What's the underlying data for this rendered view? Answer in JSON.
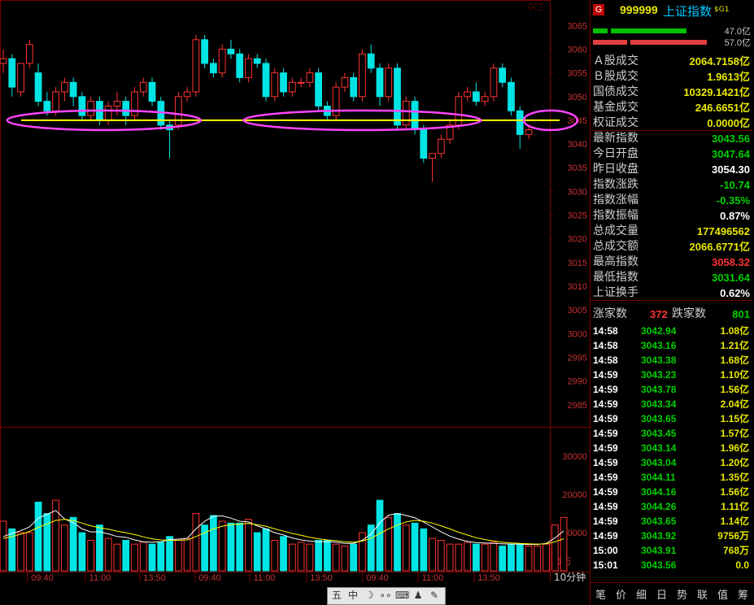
{
  "chart_data": {
    "type": "candlestick",
    "price_axis": {
      "ticks": [
        3065,
        3060,
        3055,
        3050,
        3045,
        3040,
        3035,
        3030,
        3025,
        3020,
        3015,
        3010,
        3005,
        3000,
        2995,
        2990,
        2985
      ],
      "min": 2980.5,
      "max": 3069.0
    },
    "volume_axis": {
      "ticks": [
        30000,
        20000,
        10000
      ],
      "unit_label": "X1万",
      "max": 36000
    },
    "x_tick_labels": [
      "09:40",
      "11:00",
      "13:50",
      "09:40",
      "11:00",
      "13:50",
      "09:40",
      "11:00",
      "13:50"
    ],
    "period_label": "10分钟",
    "candles": [
      {
        "o": 3057,
        "h": 3060,
        "l": 3055,
        "c": 3058
      },
      {
        "o": 3058,
        "h": 3059,
        "l": 3050,
        "c": 3052
      },
      {
        "o": 3051,
        "h": 3057,
        "l": 3050,
        "c": 3057
      },
      {
        "o": 3057,
        "h": 3062,
        "l": 3056,
        "c": 3061
      },
      {
        "o": 3055,
        "h": 3057,
        "l": 3048,
        "c": 3049
      },
      {
        "o": 3049,
        "h": 3051,
        "l": 3046,
        "c": 3047
      },
      {
        "o": 3047,
        "h": 3052,
        "l": 3046,
        "c": 3051
      },
      {
        "o": 3051,
        "h": 3054,
        "l": 3049,
        "c": 3053
      },
      {
        "o": 3053,
        "h": 3054,
        "l": 3048,
        "c": 3050
      },
      {
        "o": 3050,
        "h": 3051,
        "l": 3045,
        "c": 3046
      },
      {
        "o": 3046,
        "h": 3050,
        "l": 3045,
        "c": 3049
      },
      {
        "o": 3049,
        "h": 3050,
        "l": 3044,
        "c": 3045
      },
      {
        "o": 3045,
        "h": 3049,
        "l": 3044,
        "c": 3048
      },
      {
        "o": 3048,
        "h": 3051,
        "l": 3046,
        "c": 3049
      },
      {
        "o": 3049,
        "h": 3050,
        "l": 3044,
        "c": 3046
      },
      {
        "o": 3046,
        "h": 3052,
        "l": 3045,
        "c": 3051
      },
      {
        "o": 3051,
        "h": 3054,
        "l": 3050,
        "c": 3053
      },
      {
        "o": 3053,
        "h": 3054,
        "l": 3048,
        "c": 3049
      },
      {
        "o": 3049,
        "h": 3050,
        "l": 3043,
        "c": 3044
      },
      {
        "o": 3044,
        "h": 3045,
        "l": 3037,
        "c": 3043
      },
      {
        "o": 3044,
        "h": 3051,
        "l": 3043,
        "c": 3050
      },
      {
        "o": 3050,
        "h": 3052,
        "l": 3049,
        "c": 3051
      },
      {
        "o": 3051,
        "h": 3063,
        "l": 3050,
        "c": 3062
      },
      {
        "o": 3062,
        "h": 3063,
        "l": 3056,
        "c": 3057
      },
      {
        "o": 3057,
        "h": 3058,
        "l": 3054,
        "c": 3055
      },
      {
        "o": 3055,
        "h": 3061,
        "l": 3054,
        "c": 3060
      },
      {
        "o": 3060,
        "h": 3062,
        "l": 3058,
        "c": 3059
      },
      {
        "o": 3059,
        "h": 3060,
        "l": 3053,
        "c": 3054
      },
      {
        "o": 3054,
        "h": 3059,
        "l": 3053,
        "c": 3058
      },
      {
        "o": 3058,
        "h": 3059,
        "l": 3056,
        "c": 3057
      },
      {
        "o": 3057,
        "h": 3058,
        "l": 3049,
        "c": 3050
      },
      {
        "o": 3050,
        "h": 3056,
        "l": 3049,
        "c": 3055
      },
      {
        "o": 3055,
        "h": 3056,
        "l": 3050,
        "c": 3051
      },
      {
        "o": 3051,
        "h": 3054,
        "l": 3050,
        "c": 3053
      },
      {
        "o": 3053,
        "h": 3054,
        "l": 3052,
        "c": 3053
      },
      {
        "o": 3053,
        "h": 3056,
        "l": 3052,
        "c": 3055
      },
      {
        "o": 3055,
        "h": 3056,
        "l": 3047,
        "c": 3048
      },
      {
        "o": 3048,
        "h": 3049,
        "l": 3045,
        "c": 3046
      },
      {
        "o": 3046,
        "h": 3053,
        "l": 3045,
        "c": 3052
      },
      {
        "o": 3052,
        "h": 3055,
        "l": 3051,
        "c": 3054
      },
      {
        "o": 3054,
        "h": 3055,
        "l": 3049,
        "c": 3050
      },
      {
        "o": 3050,
        "h": 3060,
        "l": 3049,
        "c": 3059
      },
      {
        "o": 3059,
        "h": 3061,
        "l": 3055,
        "c": 3056
      },
      {
        "o": 3056,
        "h": 3057,
        "l": 3048,
        "c": 3050
      },
      {
        "o": 3050,
        "h": 3057,
        "l": 3049,
        "c": 3056
      },
      {
        "o": 3056,
        "h": 3057,
        "l": 3043,
        "c": 3044
      },
      {
        "o": 3044,
        "h": 3050,
        "l": 3043,
        "c": 3049
      },
      {
        "o": 3049,
        "h": 3050,
        "l": 3042,
        "c": 3043
      },
      {
        "o": 3043,
        "h": 3044,
        "l": 3036,
        "c": 3037
      },
      {
        "o": 3037,
        "h": 3038,
        "l": 3032,
        "c": 3038
      },
      {
        "o": 3038,
        "h": 3042,
        "l": 3037,
        "c": 3041
      },
      {
        "o": 3041,
        "h": 3045,
        "l": 3040,
        "c": 3044
      },
      {
        "o": 3044,
        "h": 3051,
        "l": 3043,
        "c": 3050
      },
      {
        "o": 3050,
        "h": 3052,
        "l": 3049,
        "c": 3051
      },
      {
        "o": 3051,
        "h": 3053,
        "l": 3048,
        "c": 3049
      },
      {
        "o": 3049,
        "h": 3051,
        "l": 3048,
        "c": 3050
      },
      {
        "o": 3050,
        "h": 3057,
        "l": 3049,
        "c": 3056
      },
      {
        "o": 3056,
        "h": 3057,
        "l": 3052,
        "c": 3053
      },
      {
        "o": 3053,
        "h": 3054,
        "l": 3046,
        "c": 3047
      },
      {
        "o": 3047,
        "h": 3048,
        "l": 3039,
        "c": 3042
      },
      {
        "o": 3042,
        "h": 3044,
        "l": 3041,
        "c": 3043
      }
    ],
    "volumes": [
      13000,
      11000,
      10000,
      10000,
      18000,
      15000,
      18500,
      12000,
      14000,
      10000,
      8000,
      12000,
      8500,
      7000,
      8000,
      7000,
      7500,
      7000,
      7500,
      9000,
      8000,
      8500,
      15000,
      12000,
      14500,
      13000,
      12500,
      12500,
      13500,
      10000,
      11000,
      8000,
      9000,
      7000,
      7500,
      7000,
      8000,
      8000,
      7000,
      6500,
      7000,
      10000,
      12000,
      18500,
      14000,
      15000,
      12000,
      12500,
      11000,
      8500,
      8000,
      7000,
      7000,
      7500,
      7000,
      7000,
      7500,
      6500,
      7000,
      7000,
      6500,
      6500,
      7000,
      12000,
      14000
    ],
    "ma_lines": [
      {
        "color": "#ffffff",
        "values": [
          9000,
          9800,
          10500,
          11500,
          13800,
          14800,
          15800,
          13600,
          12600,
          11000,
          10200,
          10200,
          9700,
          9000,
          8800,
          8100,
          7600,
          7500,
          7600,
          8200,
          8300,
          8500,
          11000,
          13000,
          14300,
          14400,
          13800,
          13000,
          12800,
          11800,
          11000,
          10000,
          9400,
          8600,
          8100,
          7800,
          7600,
          7700,
          7500,
          7200,
          7200,
          8000,
          9600,
          12600,
          14600,
          15000,
          14500,
          13900,
          12800,
          11500,
          10200,
          9100,
          8300,
          7700,
          7400,
          7300,
          7200,
          7100,
          7000,
          7000,
          6900,
          6900,
          7200,
          8600,
          10500
        ]
      },
      {
        "color": "#ffff00",
        "values": [
          8500,
          9000,
          9600,
          10300,
          11400,
          12300,
          13200,
          13500,
          13200,
          12500,
          11800,
          11300,
          10900,
          10400,
          10000,
          9500,
          8900,
          8400,
          8100,
          8000,
          8000,
          8100,
          9000,
          10000,
          11000,
          11700,
          12100,
          12300,
          12400,
          12100,
          11700,
          11000,
          10400,
          9800,
          9300,
          8800,
          8400,
          8100,
          7900,
          7600,
          7500,
          7800,
          8500,
          9800,
          11000,
          12000,
          12800,
          13200,
          13000,
          12500,
          11800,
          11000,
          10100,
          9400,
          8700,
          8200,
          7800,
          7500,
          7300,
          7200,
          7100,
          7000,
          7100,
          7600,
          8400
        ]
      }
    ],
    "support_line": 3045,
    "annotations": [
      {
        "shape": "ellipse",
        "from_candle": 1,
        "to_candle": 22,
        "level": 3045
      },
      {
        "shape": "ellipse",
        "from_candle": 28,
        "to_candle": 54,
        "level": 3045
      },
      {
        "shape": "ellipse",
        "from_candle": 60,
        "to_candle": 65,
        "level": 3045
      }
    ]
  },
  "colors": {
    "up": "#ff3232",
    "down": "#00e4e4",
    "grid": "#7a0000",
    "support": "#ffff00",
    "annotation": "#ff44ff",
    "green": "#00d000",
    "red": "#ff3232",
    "yellow": "#e8e800"
  },
  "panel": {
    "badge": "G",
    "code": "999999",
    "name": "上证指数",
    "tag": "$G1",
    "bar1_value": "47.0亿",
    "bar1_fraction": 0.45,
    "bar2_value": "57.0亿",
    "bar2_fraction": 0.55,
    "stats": [
      {
        "label": "Ａ股成交",
        "value": "2064.7158亿",
        "color": "#e8e800"
      },
      {
        "label": "Ｂ股成交",
        "value": "1.9613亿",
        "color": "#e8e800"
      },
      {
        "label": "国债成交",
        "value": "10329.1421亿",
        "color": "#e8e800"
      },
      {
        "label": "基金成交",
        "value": "246.6651亿",
        "color": "#e8e800"
      },
      {
        "label": "权证成交",
        "value": "0.0000亿",
        "color": "#e8e800"
      },
      {
        "label": "最新指数",
        "value": "3043.56",
        "color": "#00d000"
      },
      {
        "label": "今日开盘",
        "value": "3047.64",
        "color": "#00d000"
      },
      {
        "label": "昨日收盘",
        "value": "3054.30",
        "color": "#ffffff"
      },
      {
        "label": "指数涨跌",
        "value": "-10.74",
        "color": "#00d000"
      },
      {
        "label": "指数涨幅",
        "value": "-0.35%",
        "color": "#00d000"
      },
      {
        "label": "指数振幅",
        "value": "0.87%",
        "color": "#ffffff"
      },
      {
        "label": "总成交量",
        "value": "177496562",
        "color": "#e8e800"
      },
      {
        "label": "总成交额",
        "value": "2066.6771亿",
        "color": "#e8e800"
      },
      {
        "label": "最高指数",
        "value": "3058.32",
        "color": "#ff3232"
      },
      {
        "label": "最低指数",
        "value": "3031.64",
        "color": "#00d000"
      },
      {
        "label": "上证换手",
        "value": "0.62%",
        "color": "#ffffff"
      }
    ],
    "adv_label": "涨家数",
    "adv_value": "372",
    "dec_label": "跌家数",
    "dec_value": "801",
    "ticks": [
      {
        "time": "14:58",
        "price": "3042.94",
        "vol": "1.08亿"
      },
      {
        "time": "14:58",
        "price": "3043.16",
        "vol": "1.21亿"
      },
      {
        "time": "14:58",
        "price": "3043.38",
        "vol": "1.68亿"
      },
      {
        "time": "14:59",
        "price": "3043.23",
        "vol": "1.10亿"
      },
      {
        "time": "14:59",
        "price": "3043.78",
        "vol": "1.56亿"
      },
      {
        "time": "14:59",
        "price": "3043.34",
        "vol": "2.04亿"
      },
      {
        "time": "14:59",
        "price": "3043.65",
        "vol": "1.15亿"
      },
      {
        "time": "14:59",
        "price": "3043.45",
        "vol": "1.57亿"
      },
      {
        "time": "14:59",
        "price": "3043.14",
        "vol": "1.96亿"
      },
      {
        "time": "14:59",
        "price": "3043.04",
        "vol": "1.20亿"
      },
      {
        "time": "14:59",
        "price": "3044.11",
        "vol": "1.35亿"
      },
      {
        "time": "14:59",
        "price": "3044.16",
        "vol": "1.56亿"
      },
      {
        "time": "14:59",
        "price": "3044.26",
        "vol": "1.11亿"
      },
      {
        "time": "14:59",
        "price": "3043.65",
        "vol": "1.14亿"
      },
      {
        "time": "14:59",
        "price": "3043.92",
        "vol": "9756万"
      },
      {
        "time": "15:00",
        "price": "3043.91",
        "vol": "768万"
      },
      {
        "time": "15:01",
        "price": "3043.56",
        "vol": "0.0"
      }
    ],
    "tabs": [
      "笔",
      "价",
      "细",
      "日",
      "势",
      "联",
      "值",
      "筹"
    ]
  },
  "toolbar": {
    "items": [
      "五",
      "中",
      "☽",
      "∘∘",
      "⌨",
      "♟",
      "✎"
    ],
    "icons": [
      "five-icon",
      "chinese-input-icon",
      "moon-icon",
      "dots-icon",
      "keyboard-icon",
      "user-icon",
      "wrench-icon"
    ]
  },
  "corner_icon": "◇□"
}
